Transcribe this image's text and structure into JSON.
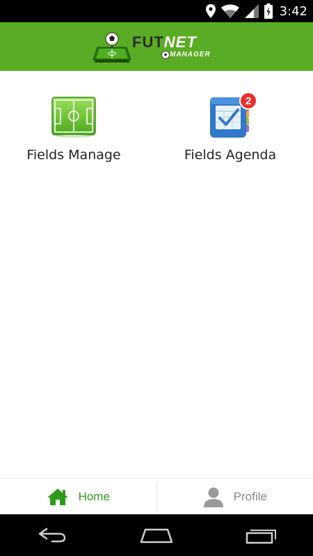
{
  "status_bar": {
    "time": "3:42",
    "battery_level": 0.7,
    "icons": [
      "location-icon",
      "wifi-icon",
      "signal-icon",
      "battery-icon"
    ]
  },
  "header": {
    "logo_text_fut": "FUT",
    "logo_text_net": "NET",
    "logo_subtext": "MANAGER",
    "background_color": "#5aac24"
  },
  "menu": {
    "fields_manage_label": "Fields Manage",
    "fields_agenda_label": "Fields Agenda",
    "agenda_badge_count": "2"
  },
  "bottom_nav": {
    "home_label": "Home",
    "profile_label": "Profile",
    "active_color": "#2e9a1c",
    "inactive_color": "#888888"
  },
  "system_nav": {
    "buttons": [
      "back-icon",
      "home-icon",
      "recents-icon"
    ]
  }
}
